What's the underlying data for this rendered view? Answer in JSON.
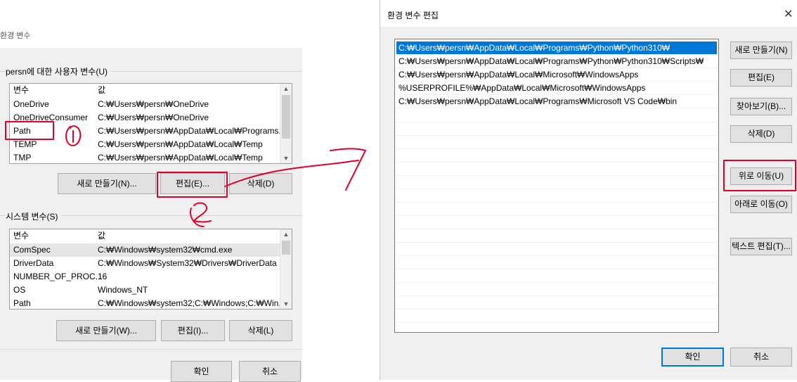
{
  "left": {
    "title": "환경 변수",
    "user_group_label": "persn에 대한 사용자 변수(U)",
    "user_columns": [
      "변수",
      "값"
    ],
    "user_rows": [
      {
        "name": "OneDrive",
        "value": "C:₩Users₩persn₩OneDrive"
      },
      {
        "name": "OneDriveConsumer",
        "value": "C:₩Users₩persn₩OneDrive"
      },
      {
        "name": "Path",
        "value": "C:₩Users₩persn₩AppData₩Local₩Programs..."
      },
      {
        "name": "TEMP",
        "value": "C:₩Users₩persn₩AppData₩Local₩Temp"
      },
      {
        "name": "TMP",
        "value": "C:₩Users₩persn₩AppData₩Local₩Temp"
      }
    ],
    "user_buttons": {
      "new": "새로 만들기(N)...",
      "edit": "편집(E)...",
      "delete": "삭제(D)"
    },
    "system_group_label": "시스템 변수(S)",
    "system_columns": [
      "변수",
      "값"
    ],
    "system_rows": [
      {
        "name": "ComSpec",
        "value": "C:₩Windows₩system32₩cmd.exe"
      },
      {
        "name": "DriverData",
        "value": "C:₩Windows₩System32₩Drivers₩DriverData"
      },
      {
        "name": "NUMBER_OF_PROC...",
        "value": "16"
      },
      {
        "name": "OS",
        "value": "Windows_NT"
      },
      {
        "name": "Path",
        "value": "C:₩Windows₩system32;C:₩Windows;C:₩Win..."
      }
    ],
    "system_buttons": {
      "new": "새로 만들기(W)...",
      "edit": "편집(I)...",
      "delete": "삭제(L)"
    },
    "ok": "확인",
    "cancel": "취소"
  },
  "right": {
    "title": "환경 변수 편집",
    "close_icon": "close-icon",
    "paths": [
      "C:₩Users₩persn₩AppData₩Local₩Programs₩Python₩Python310₩",
      "C:₩Users₩persn₩AppData₩Local₩Programs₩Python₩Python310₩Scripts₩",
      "C:₩Users₩persn₩AppData₩Local₩Microsoft₩WindowsApps",
      "%USERPROFILE%₩AppData₩Local₩Microsoft₩WindowsApps",
      "C:₩Users₩persn₩AppData₩Local₩Programs₩Microsoft VS Code₩bin"
    ],
    "buttons": {
      "new": "새로 만들기(N)",
      "edit": "편집(E)",
      "browse": "찾아보기(B)...",
      "delete": "삭제(D)",
      "move_up": "위로 이동(U)",
      "move_down": "아래로 이동(O)",
      "edit_text": "텍스트 편집(T)..."
    },
    "ok": "확인",
    "cancel": "취소"
  },
  "colors": {
    "annotation": "#e0002a",
    "selection": "#0078d7"
  }
}
